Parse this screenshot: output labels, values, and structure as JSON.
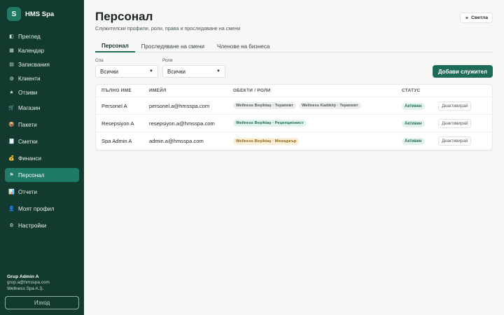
{
  "brand": {
    "logo_letter": "S",
    "name": "HMS Spa"
  },
  "nav": [
    {
      "icon": "overview-icon",
      "glyph": "◧",
      "label": "Преглед",
      "name": "nav-item-overview"
    },
    {
      "icon": "calendar-icon",
      "glyph": "▦",
      "label": "Календар",
      "name": "nav-item-calendar"
    },
    {
      "icon": "appointments-icon",
      "glyph": "▤",
      "label": "Записвания",
      "name": "nav-item-appointments"
    },
    {
      "icon": "clients-icon",
      "glyph": "◍",
      "label": "Клиенти",
      "name": "nav-item-clients"
    },
    {
      "icon": "star-icon",
      "glyph": "★",
      "label": "Отзиви",
      "name": "nav-item-reviews"
    },
    {
      "icon": "cart-icon",
      "glyph": "🛒",
      "label": "Магазин",
      "name": "nav-item-shop"
    },
    {
      "icon": "package-icon",
      "glyph": "📦",
      "label": "Пакети",
      "name": "nav-item-packages"
    },
    {
      "icon": "invoice-icon",
      "glyph": "🧾",
      "label": "Сметки",
      "name": "nav-item-bills"
    },
    {
      "icon": "money-bag-icon",
      "glyph": "💰",
      "label": "Финанси",
      "name": "nav-item-finance"
    },
    {
      "icon": "flag-icon",
      "glyph": "⚑",
      "label": "Персонал",
      "name": "nav-item-staff"
    },
    {
      "icon": "chart-icon",
      "glyph": "📊",
      "label": "Отчети",
      "name": "nav-item-reports"
    },
    {
      "icon": "user-icon",
      "glyph": "👤",
      "label": "Моят профил",
      "name": "nav-item-profile"
    },
    {
      "icon": "gear-icon",
      "glyph": "⚙",
      "label": "Настройки",
      "name": "nav-item-settings"
    }
  ],
  "active_nav_index": 9,
  "user": {
    "name": "Grup Admin A",
    "email": "grup.a@hmsspa.com",
    "company": "Wellness Spa A.Ş.",
    "logout_label": "Изход"
  },
  "page": {
    "title": "Персонал",
    "subtitle": "Служителски профили, роли, права и проследяване на смени",
    "theme_label": "Светла",
    "theme_glyph": "☀"
  },
  "tabs": [
    {
      "label": "Персонал",
      "active": true
    },
    {
      "label": "Проследяване на смени",
      "active": false
    },
    {
      "label": "Членове на бизнеса",
      "active": false
    }
  ],
  "filters": {
    "spa_label": "Спа",
    "spa_value": "Всички",
    "role_label": "Роля",
    "role_value": "Всички"
  },
  "add_button_label": "Добави служител",
  "table": {
    "headers": [
      "ПЪЛНО ИМЕ",
      "ИМЕЙЛ",
      "ОБЕКТИ / РОЛИ",
      "СТАТУС",
      ""
    ],
    "rows": [
      {
        "name": "Personel A",
        "email": "personel.a@hmsspa.com",
        "roles": [
          {
            "text": "Wellness Beşiktaş · Терапевт",
            "style": "grey"
          },
          {
            "text": "Wellness Kadıköy · Терапевт",
            "style": "grey"
          }
        ],
        "status": "Активен",
        "action": "Деактивирай"
      },
      {
        "name": "Resepsiyon A",
        "email": "resepsiyon.a@hmsspa.com",
        "roles": [
          {
            "text": "Wellness Beşiktaş · Рецепционист",
            "style": "green"
          }
        ],
        "status": "Активен",
        "action": "Деактивирай"
      },
      {
        "name": "Spa Admin A",
        "email": "admin.a@hmsspa.com",
        "roles": [
          {
            "text": "Wellness Beşiktaş · Мениджър",
            "style": "amber"
          }
        ],
        "status": "Активен",
        "action": "Деактивирай"
      }
    ]
  },
  "colors": {
    "sidebar_bg": "#123a2f",
    "accent": "#1f6b5a",
    "active_nav": "#1f7a66"
  }
}
